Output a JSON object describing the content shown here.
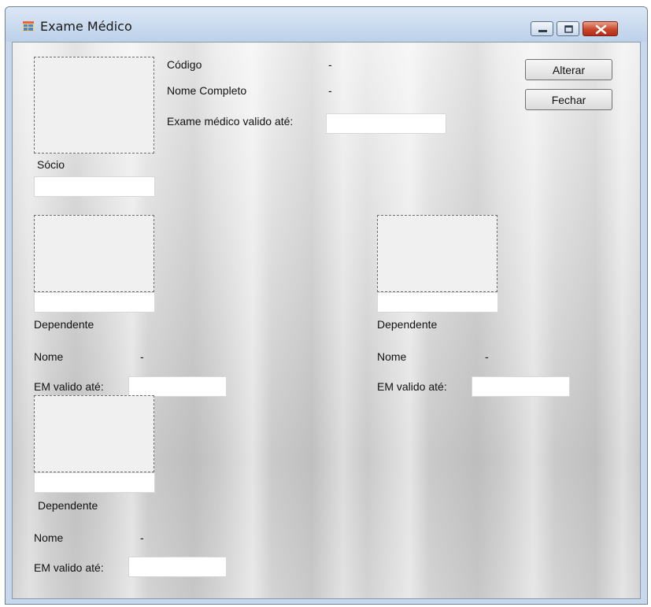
{
  "window": {
    "title": "Exame Médico",
    "icon": "app-form-icon",
    "controls": [
      "minimize-icon",
      "maximize-icon",
      "close-icon"
    ]
  },
  "buttons": {
    "alterar": "Alterar",
    "fechar": "Fechar"
  },
  "socio": {
    "codigo_label": "Código",
    "codigo_value": "-",
    "nome_completo_label": "Nome Completo",
    "nome_completo_value": "-",
    "exame_label": "Exame médico valido até:",
    "exame_value": "",
    "caption": "Sócio",
    "name_field_value": ""
  },
  "dependentes": [
    {
      "label": "Dependente",
      "nome_label": "Nome",
      "nome_value": "-",
      "em_label": "EM valido até:",
      "em_value": "",
      "name_field_value": ""
    },
    {
      "label": "Dependente",
      "nome_label": "Nome",
      "nome_value": "-",
      "em_label": "EM valido até:",
      "em_value": "",
      "name_field_value": ""
    },
    {
      "label": "Dependente",
      "nome_label": "Nome",
      "nome_value": "-",
      "em_label": "EM valido até:",
      "em_value": "",
      "name_field_value": ""
    }
  ]
}
